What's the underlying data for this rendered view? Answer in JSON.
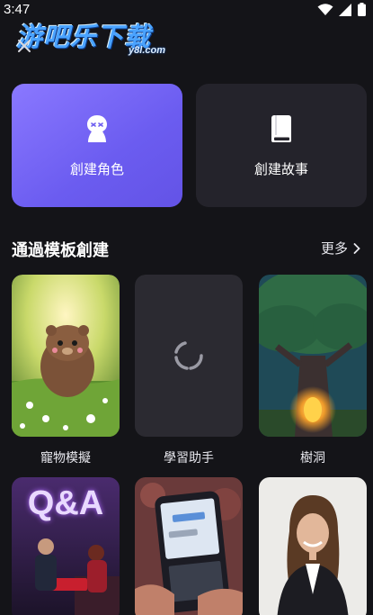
{
  "status_bar": {
    "time": "3:47",
    "icons": [
      "wifi-icon",
      "signal-icon",
      "battery-icon"
    ]
  },
  "watermark": {
    "cn_text": "游吧乐下载",
    "en_text": "y8l.com"
  },
  "actions": {
    "create_character": {
      "label": "創建角色",
      "icon": "character-icon",
      "bg": "#7464f5"
    },
    "create_story": {
      "label": "創建故事",
      "icon": "book-icon",
      "bg": "#24232b"
    }
  },
  "section": {
    "title": "通過模板創建",
    "more_label": "更多"
  },
  "templates": [
    {
      "label": "寵物模擬",
      "image": "cartoon-bear-in-meadow"
    },
    {
      "label": "學習助手",
      "image": "loading-spinner"
    },
    {
      "label": "樹洞",
      "image": "glowing-tree-hollow"
    }
  ],
  "templates_row2": [
    {
      "image": "qa-game-show",
      "title_text": "Q&A"
    },
    {
      "image": "phone-chat-keyboard"
    },
    {
      "image": "smiling-businesswoman"
    }
  ]
}
